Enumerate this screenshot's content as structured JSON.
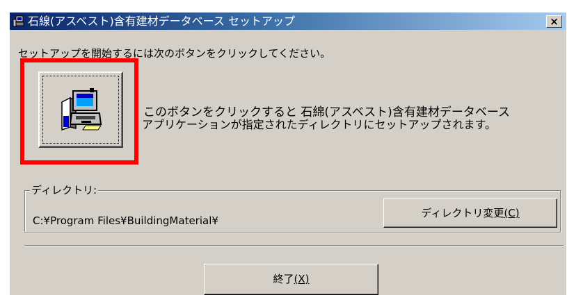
{
  "window": {
    "title": "石線(アスベスト)含有建材データベース セットアップ",
    "close_glyph": "×"
  },
  "instruction": "セットアップを開始するには次のボタンをクリックしてください。",
  "setup_button": {
    "icon": "setup-computer-icon"
  },
  "description": {
    "line1": "このボタンをクリックすると 石綿(アスベスト)含有建材データベース",
    "line2": "アプリケーションが指定されたディレクトリにセットアップされます。"
  },
  "directory": {
    "legend": "ディレクトリ:",
    "path": "C:¥Program Files¥BuildingMaterial¥",
    "change_button_label": "ディレクトリ変更",
    "change_button_hotkey": "(C)"
  },
  "exit_button": {
    "label": "終了",
    "hotkey": "(X)"
  },
  "colors": {
    "highlight": "#ff0000",
    "titlebar_start": "#0a246a",
    "titlebar_end": "#a6caf0",
    "dialog_face": "#d4d0c8"
  }
}
